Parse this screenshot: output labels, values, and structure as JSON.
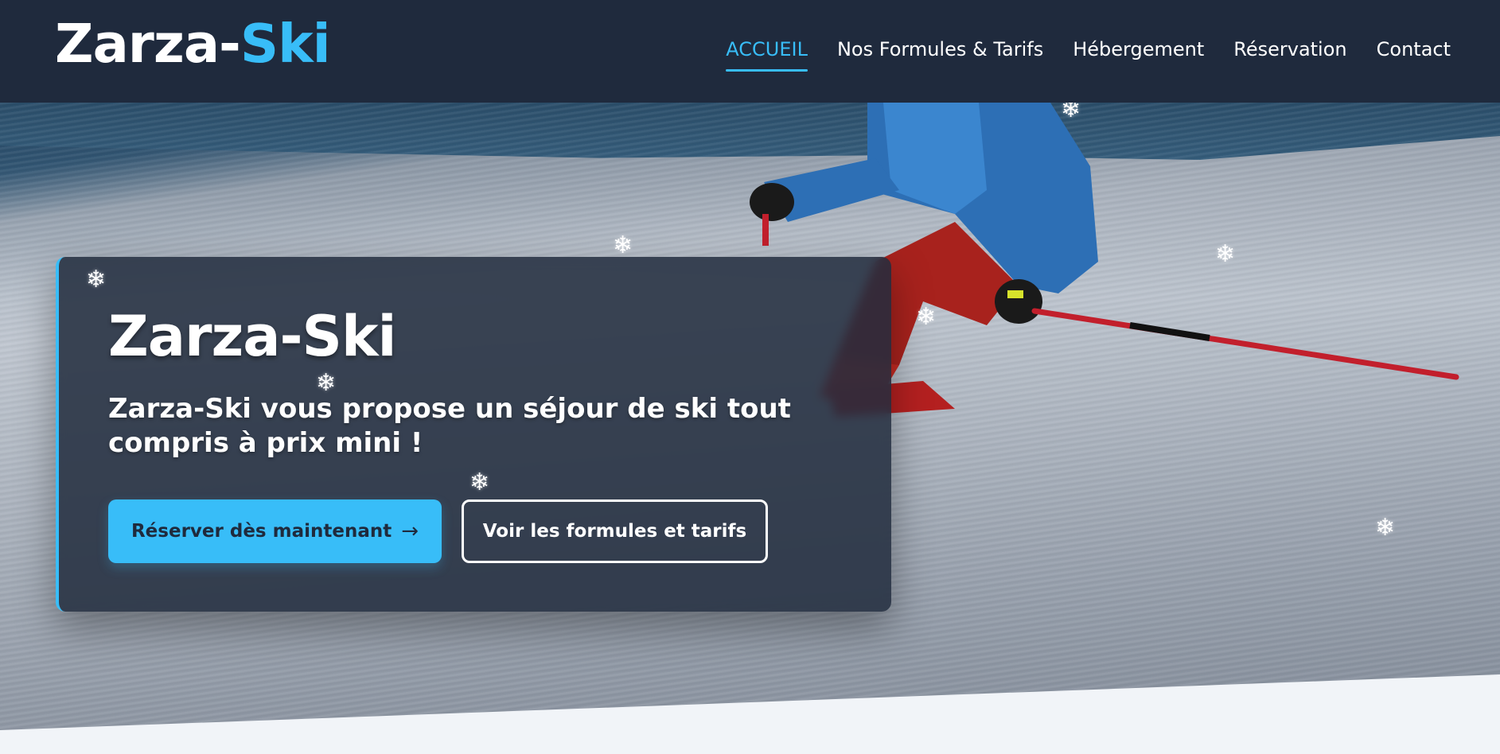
{
  "header": {
    "logo_main": "Zarza-",
    "logo_accent": "Ski",
    "colors": {
      "background": "#1f2a3d",
      "accent": "#38bdf8"
    }
  },
  "nav": {
    "items": [
      {
        "label": "ACCUEIL",
        "active": true
      },
      {
        "label": "Nos Formules & Tarifs",
        "active": false
      },
      {
        "label": "Hébergement",
        "active": false
      },
      {
        "label": "Réservation",
        "active": false
      },
      {
        "label": "Contact",
        "active": false
      }
    ]
  },
  "hero": {
    "title": "Zarza-Ski",
    "subtitle": "Zarza-Ski vous propose un séjour de ski tout compris à prix mini !",
    "primary_button": {
      "label": "Réserver dès maintenant",
      "arrow": "→"
    },
    "secondary_button": {
      "label": "Voir les formules et tarifs"
    },
    "snowflake_glyph": "❄"
  }
}
